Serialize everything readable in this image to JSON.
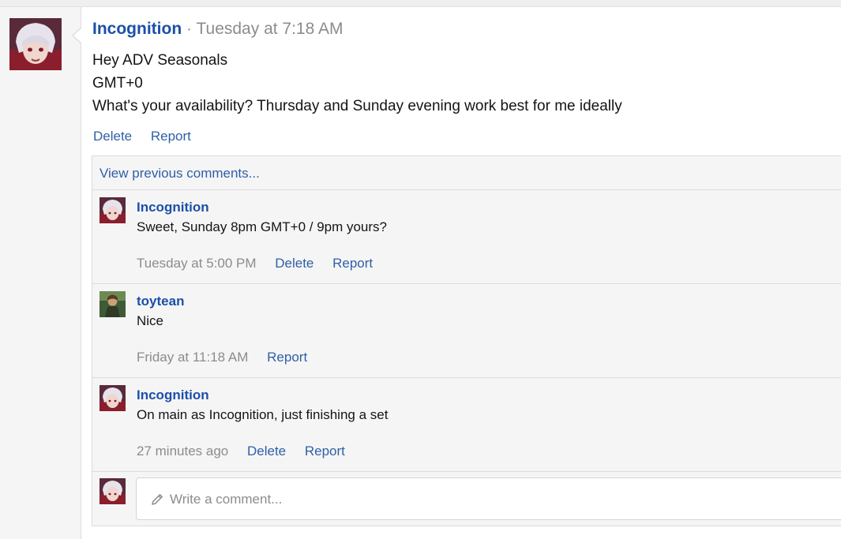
{
  "post": {
    "author": "Incognition",
    "separator": "·",
    "time": "Tuesday at 7:18 AM",
    "lines": [
      "Hey ADV Seasonals",
      "GMT+0",
      "What's your availability? Thursday and Sunday evening work best for me ideally"
    ],
    "actions": [
      "Delete",
      "Report"
    ]
  },
  "comments": {
    "view_previous": "View previous comments...",
    "items": [
      {
        "author": "Incognition",
        "text": "Sweet, Sunday 8pm GMT+0 / 9pm yours?",
        "time": "Tuesday at 5:00 PM",
        "actions": [
          "Delete",
          "Report"
        ]
      },
      {
        "author": "toytean",
        "text": "Nice",
        "time": "Friday at 11:18 AM",
        "actions": [
          "Report"
        ]
      },
      {
        "author": "Incognition",
        "text": "On main as Incognition, just finishing a set",
        "time": "27 minutes ago",
        "actions": [
          "Delete",
          "Report"
        ]
      }
    ]
  },
  "reply": {
    "placeholder": "Write a comment..."
  },
  "colors": {
    "username": "#1b4fa8",
    "link": "#2f5fa8",
    "muted": "#8c8c8c"
  }
}
